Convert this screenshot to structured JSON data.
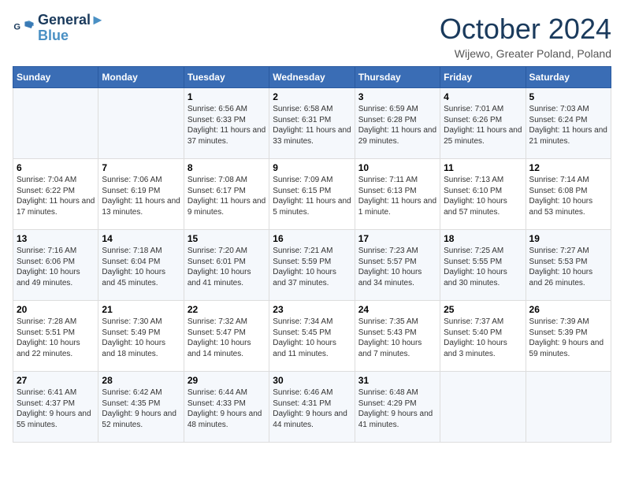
{
  "header": {
    "logo_line1": "General",
    "logo_line2": "Blue",
    "title": "October 2024",
    "location": "Wijewo, Greater Poland, Poland"
  },
  "weekdays": [
    "Sunday",
    "Monday",
    "Tuesday",
    "Wednesday",
    "Thursday",
    "Friday",
    "Saturday"
  ],
  "weeks": [
    [
      {
        "day": "",
        "info": ""
      },
      {
        "day": "",
        "info": ""
      },
      {
        "day": "1",
        "info": "Sunrise: 6:56 AM\nSunset: 6:33 PM\nDaylight: 11 hours and 37 minutes."
      },
      {
        "day": "2",
        "info": "Sunrise: 6:58 AM\nSunset: 6:31 PM\nDaylight: 11 hours and 33 minutes."
      },
      {
        "day": "3",
        "info": "Sunrise: 6:59 AM\nSunset: 6:28 PM\nDaylight: 11 hours and 29 minutes."
      },
      {
        "day": "4",
        "info": "Sunrise: 7:01 AM\nSunset: 6:26 PM\nDaylight: 11 hours and 25 minutes."
      },
      {
        "day": "5",
        "info": "Sunrise: 7:03 AM\nSunset: 6:24 PM\nDaylight: 11 hours and 21 minutes."
      }
    ],
    [
      {
        "day": "6",
        "info": "Sunrise: 7:04 AM\nSunset: 6:22 PM\nDaylight: 11 hours and 17 minutes."
      },
      {
        "day": "7",
        "info": "Sunrise: 7:06 AM\nSunset: 6:19 PM\nDaylight: 11 hours and 13 minutes."
      },
      {
        "day": "8",
        "info": "Sunrise: 7:08 AM\nSunset: 6:17 PM\nDaylight: 11 hours and 9 minutes."
      },
      {
        "day": "9",
        "info": "Sunrise: 7:09 AM\nSunset: 6:15 PM\nDaylight: 11 hours and 5 minutes."
      },
      {
        "day": "10",
        "info": "Sunrise: 7:11 AM\nSunset: 6:13 PM\nDaylight: 11 hours and 1 minute."
      },
      {
        "day": "11",
        "info": "Sunrise: 7:13 AM\nSunset: 6:10 PM\nDaylight: 10 hours and 57 minutes."
      },
      {
        "day": "12",
        "info": "Sunrise: 7:14 AM\nSunset: 6:08 PM\nDaylight: 10 hours and 53 minutes."
      }
    ],
    [
      {
        "day": "13",
        "info": "Sunrise: 7:16 AM\nSunset: 6:06 PM\nDaylight: 10 hours and 49 minutes."
      },
      {
        "day": "14",
        "info": "Sunrise: 7:18 AM\nSunset: 6:04 PM\nDaylight: 10 hours and 45 minutes."
      },
      {
        "day": "15",
        "info": "Sunrise: 7:20 AM\nSunset: 6:01 PM\nDaylight: 10 hours and 41 minutes."
      },
      {
        "day": "16",
        "info": "Sunrise: 7:21 AM\nSunset: 5:59 PM\nDaylight: 10 hours and 37 minutes."
      },
      {
        "day": "17",
        "info": "Sunrise: 7:23 AM\nSunset: 5:57 PM\nDaylight: 10 hours and 34 minutes."
      },
      {
        "day": "18",
        "info": "Sunrise: 7:25 AM\nSunset: 5:55 PM\nDaylight: 10 hours and 30 minutes."
      },
      {
        "day": "19",
        "info": "Sunrise: 7:27 AM\nSunset: 5:53 PM\nDaylight: 10 hours and 26 minutes."
      }
    ],
    [
      {
        "day": "20",
        "info": "Sunrise: 7:28 AM\nSunset: 5:51 PM\nDaylight: 10 hours and 22 minutes."
      },
      {
        "day": "21",
        "info": "Sunrise: 7:30 AM\nSunset: 5:49 PM\nDaylight: 10 hours and 18 minutes."
      },
      {
        "day": "22",
        "info": "Sunrise: 7:32 AM\nSunset: 5:47 PM\nDaylight: 10 hours and 14 minutes."
      },
      {
        "day": "23",
        "info": "Sunrise: 7:34 AM\nSunset: 5:45 PM\nDaylight: 10 hours and 11 minutes."
      },
      {
        "day": "24",
        "info": "Sunrise: 7:35 AM\nSunset: 5:43 PM\nDaylight: 10 hours and 7 minutes."
      },
      {
        "day": "25",
        "info": "Sunrise: 7:37 AM\nSunset: 5:40 PM\nDaylight: 10 hours and 3 minutes."
      },
      {
        "day": "26",
        "info": "Sunrise: 7:39 AM\nSunset: 5:39 PM\nDaylight: 9 hours and 59 minutes."
      }
    ],
    [
      {
        "day": "27",
        "info": "Sunrise: 6:41 AM\nSunset: 4:37 PM\nDaylight: 9 hours and 55 minutes."
      },
      {
        "day": "28",
        "info": "Sunrise: 6:42 AM\nSunset: 4:35 PM\nDaylight: 9 hours and 52 minutes."
      },
      {
        "day": "29",
        "info": "Sunrise: 6:44 AM\nSunset: 4:33 PM\nDaylight: 9 hours and 48 minutes."
      },
      {
        "day": "30",
        "info": "Sunrise: 6:46 AM\nSunset: 4:31 PM\nDaylight: 9 hours and 44 minutes."
      },
      {
        "day": "31",
        "info": "Sunrise: 6:48 AM\nSunset: 4:29 PM\nDaylight: 9 hours and 41 minutes."
      },
      {
        "day": "",
        "info": ""
      },
      {
        "day": "",
        "info": ""
      }
    ]
  ]
}
